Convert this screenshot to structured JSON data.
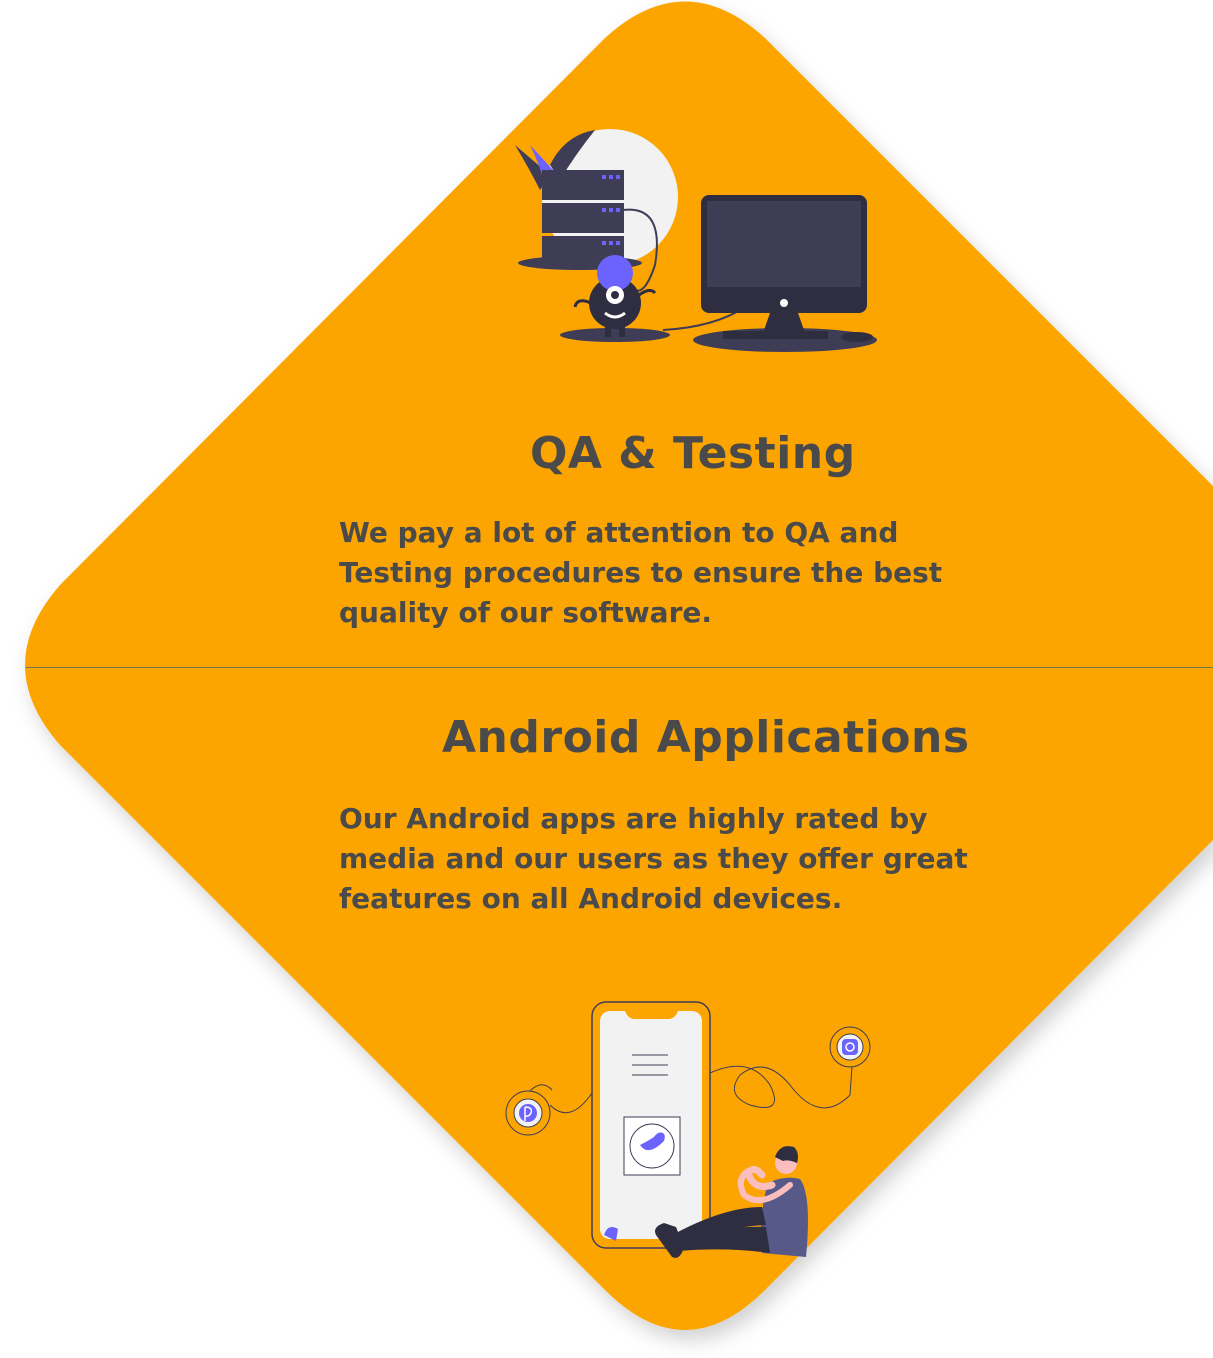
{
  "colors": {
    "card_background": "#FCA501",
    "text": "#4A4A4A",
    "illustration_dark": "#3F3D56",
    "illustration_accent": "#6C63FF",
    "divider": "#6A7A4A"
  },
  "sections": {
    "qa": {
      "title": "QA & Testing",
      "description": "We pay a lot of attention to QA and Testing procedures to ensure the best quality of our software.",
      "illustration_icon": "server-monitor-robot-illustration"
    },
    "android": {
      "title": "Android Applications",
      "description": "Our Android apps are highly rated by media and our users as they offer great features on all Android devices.",
      "illustration_icon": "phone-social-person-illustration"
    }
  }
}
